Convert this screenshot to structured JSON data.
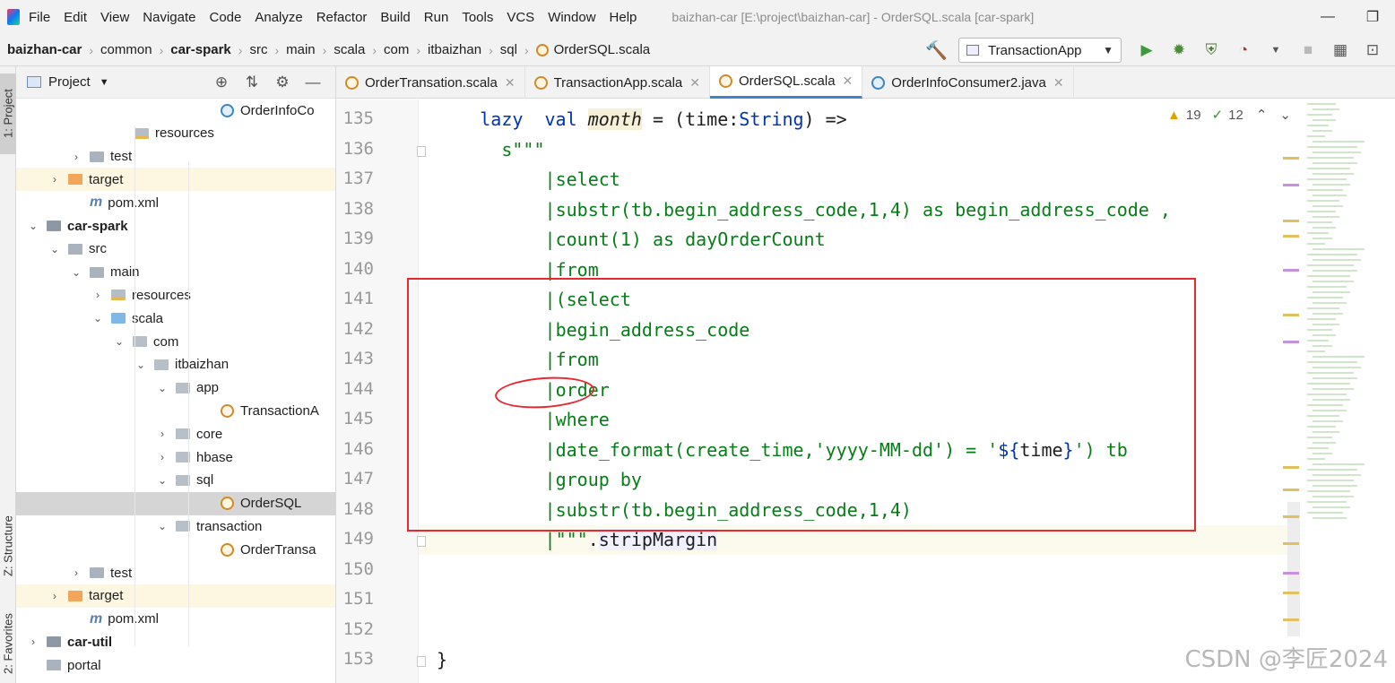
{
  "menubar": {
    "items": [
      "File",
      "Edit",
      "View",
      "Navigate",
      "Code",
      "Analyze",
      "Refactor",
      "Build",
      "Run",
      "Tools",
      "VCS",
      "Window",
      "Help"
    ],
    "window_title": "baizhan-car [E:\\project\\baizhan-car] - OrderSQL.scala [car-spark]"
  },
  "breadcrumb": [
    "baizhan-car",
    "common",
    "car-spark",
    "src",
    "main",
    "scala",
    "com",
    "itbaizhan",
    "sql",
    "OrderSQL.scala"
  ],
  "toolbar": {
    "run_config": "TransactionApp"
  },
  "stripe": {
    "project": "1: Project",
    "structure": "Z: Structure",
    "favorites": "2: Favorites"
  },
  "project_panel": {
    "title": "Project",
    "tree": [
      {
        "label": "OrderInfoCo",
        "icon": "java-class-icon",
        "indent": 246,
        "arrow": ""
      },
      {
        "label": "resources",
        "icon": "resources-folder-icon",
        "indent": 150,
        "arrow": ""
      },
      {
        "label": "test",
        "icon": "folder-icon",
        "indent": 100,
        "arrow": "›"
      },
      {
        "label": "target",
        "icon": "excluded-folder-icon",
        "indent": 76,
        "arrow": "›"
      },
      {
        "label": "pom.xml",
        "icon": "maven-icon",
        "indent": 100,
        "arrow": ""
      },
      {
        "label": "car-spark",
        "icon": "module-folder-icon",
        "indent": 52,
        "arrow": "⌄"
      },
      {
        "label": "src",
        "icon": "folder-icon",
        "indent": 76,
        "arrow": "⌄"
      },
      {
        "label": "main",
        "icon": "folder-icon",
        "indent": 100,
        "arrow": "⌄"
      },
      {
        "label": "resources",
        "icon": "resources-folder-icon",
        "indent": 124,
        "arrow": "›"
      },
      {
        "label": "scala",
        "icon": "source-folder-icon",
        "indent": 124,
        "arrow": "⌄"
      },
      {
        "label": "com",
        "icon": "package-icon",
        "indent": 148,
        "arrow": "⌄"
      },
      {
        "label": "itbaizhan",
        "icon": "package-icon",
        "indent": 172,
        "arrow": "⌄"
      },
      {
        "label": "app",
        "icon": "package-icon",
        "indent": 196,
        "arrow": "⌄"
      },
      {
        "label": "TransactionA",
        "icon": "scala-object-icon",
        "indent": 246,
        "arrow": ""
      },
      {
        "label": "core",
        "icon": "package-icon",
        "indent": 196,
        "arrow": "›"
      },
      {
        "label": "hbase",
        "icon": "package-icon",
        "indent": 196,
        "arrow": "›"
      },
      {
        "label": "sql",
        "icon": "package-icon",
        "indent": 196,
        "arrow": "⌄"
      },
      {
        "label": "OrderSQL",
        "icon": "scala-object-icon",
        "indent": 246,
        "arrow": ""
      },
      {
        "label": "transaction",
        "icon": "package-icon",
        "indent": 196,
        "arrow": "⌄"
      },
      {
        "label": "OrderTransa",
        "icon": "scala-object-icon",
        "indent": 246,
        "arrow": ""
      },
      {
        "label": "test",
        "icon": "folder-icon",
        "indent": 100,
        "arrow": "›"
      },
      {
        "label": "target",
        "icon": "excluded-folder-icon",
        "indent": 76,
        "arrow": "›"
      },
      {
        "label": "pom.xml",
        "icon": "maven-icon",
        "indent": 100,
        "arrow": ""
      },
      {
        "label": "car-util",
        "icon": "module-folder-icon",
        "indent": 52,
        "arrow": "›"
      },
      {
        "label": "portal",
        "icon": "folder-icon",
        "indent": 52,
        "arrow": ""
      }
    ]
  },
  "tabs": [
    {
      "label": "OrderTransation.scala",
      "icon": "scala-object-icon",
      "active": false
    },
    {
      "label": "TransactionApp.scala",
      "icon": "scala-object-icon",
      "active": false
    },
    {
      "label": "OrderSQL.scala",
      "icon": "scala-object-icon",
      "active": true
    },
    {
      "label": "OrderInfoConsumer2.java",
      "icon": "java-class-icon",
      "active": false
    }
  ],
  "inspections": {
    "warnings": "19",
    "typos": "12"
  },
  "editor": {
    "lines": [
      {
        "n": "135",
        "html": "<span class=\"kw\">lazy</span>  <span class=\"kw\">val</span> <span class=\"fn\">month</span> = (time:<span class=\"tp\">String</span>) =>",
        "indent": 5
      },
      {
        "n": "136",
        "html": "<span class=\"str\">s\"\"\"</span>",
        "indent": 7
      },
      {
        "n": "137",
        "html": "<span class=\"str\">|select</span>",
        "indent": 11
      },
      {
        "n": "138",
        "html": "<span class=\"str\">|substr(tb.begin_address_code,1,4) as begin_address_code ,</span>",
        "indent": 11
      },
      {
        "n": "139",
        "html": "<span class=\"str\">|count(1) as dayOrderCount</span>",
        "indent": 11
      },
      {
        "n": "140",
        "html": "<span class=\"str\">|from</span>",
        "indent": 11
      },
      {
        "n": "141",
        "html": "<span class=\"str\">|(select</span>",
        "indent": 11
      },
      {
        "n": "142",
        "html": "<span class=\"str\">|begin_address_code</span>",
        "indent": 11
      },
      {
        "n": "143",
        "html": "<span class=\"str\">|from</span>",
        "indent": 11
      },
      {
        "n": "144",
        "html": "<span class=\"str\">|order</span>",
        "indent": 11
      },
      {
        "n": "145",
        "html": "<span class=\"str\">|where</span>",
        "indent": 11
      },
      {
        "n": "146",
        "html": "<span class=\"str\">|date_format(create_time,'yyyy-MM-dd') = '</span><span class=\"tmpl\">${</span><span class=\"plain\">time</span><span class=\"tmpl\">}</span><span class=\"str\">') tb</span>",
        "indent": 11
      },
      {
        "n": "147",
        "html": "<span class=\"str\">|group by</span>",
        "indent": 11
      },
      {
        "n": "148",
        "html": "<span class=\"str\">|substr(tb.begin_address_code,1,4)</span>",
        "indent": 11
      },
      {
        "n": "149",
        "html": "<span class=\"str\">|\"\"\"</span>.<span class=\"mth\">stripMargin</span>",
        "indent": 11
      },
      {
        "n": "150",
        "html": "",
        "indent": 0
      },
      {
        "n": "151",
        "html": "",
        "indent": 0
      },
      {
        "n": "152",
        "html": "",
        "indent": 0
      },
      {
        "n": "153",
        "html": "}",
        "indent": 1
      }
    ]
  },
  "watermark": "CSDN @李匠2024"
}
